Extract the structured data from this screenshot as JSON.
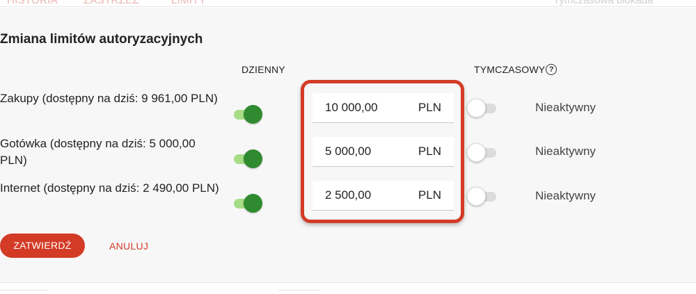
{
  "tabs": [
    "HISTORIA",
    "ZASTRZEŻ",
    "LIMITY",
    "Tymczasowa blokada"
  ],
  "dialog": {
    "title": "Zmiana limitów autoryzacyjnych",
    "col_daily": "DZIENNY",
    "col_temporary": "TYMCZASOWY",
    "help_symbol": "?"
  },
  "rows": [
    {
      "label": "Zakupy (dostępny na dziś: 9 961,00 PLN)",
      "daily_enabled": true,
      "amount": "10 000,00",
      "currency": "PLN",
      "temporary_enabled": false,
      "status": "Nieaktywny"
    },
    {
      "label": "Gotówka (dostępny na dziś: 5 000,00 PLN)",
      "daily_enabled": true,
      "amount": "5 000,00",
      "currency": "PLN",
      "temporary_enabled": false,
      "status": "Nieaktywny"
    },
    {
      "label": "Internet (dostępny na dziś: 2 490,00 PLN)",
      "daily_enabled": true,
      "amount": "2 500,00",
      "currency": "PLN",
      "temporary_enabled": false,
      "status": "Nieaktywny"
    }
  ],
  "actions": {
    "confirm_label": "ZATWIERDŹ",
    "cancel_label": "ANULUJ"
  },
  "colors": {
    "accent": "#d33b27",
    "toggle_on": "#2f8a30",
    "toggle_on_track": "#a6dd86",
    "toggle_off_track": "#dcdcdc"
  }
}
